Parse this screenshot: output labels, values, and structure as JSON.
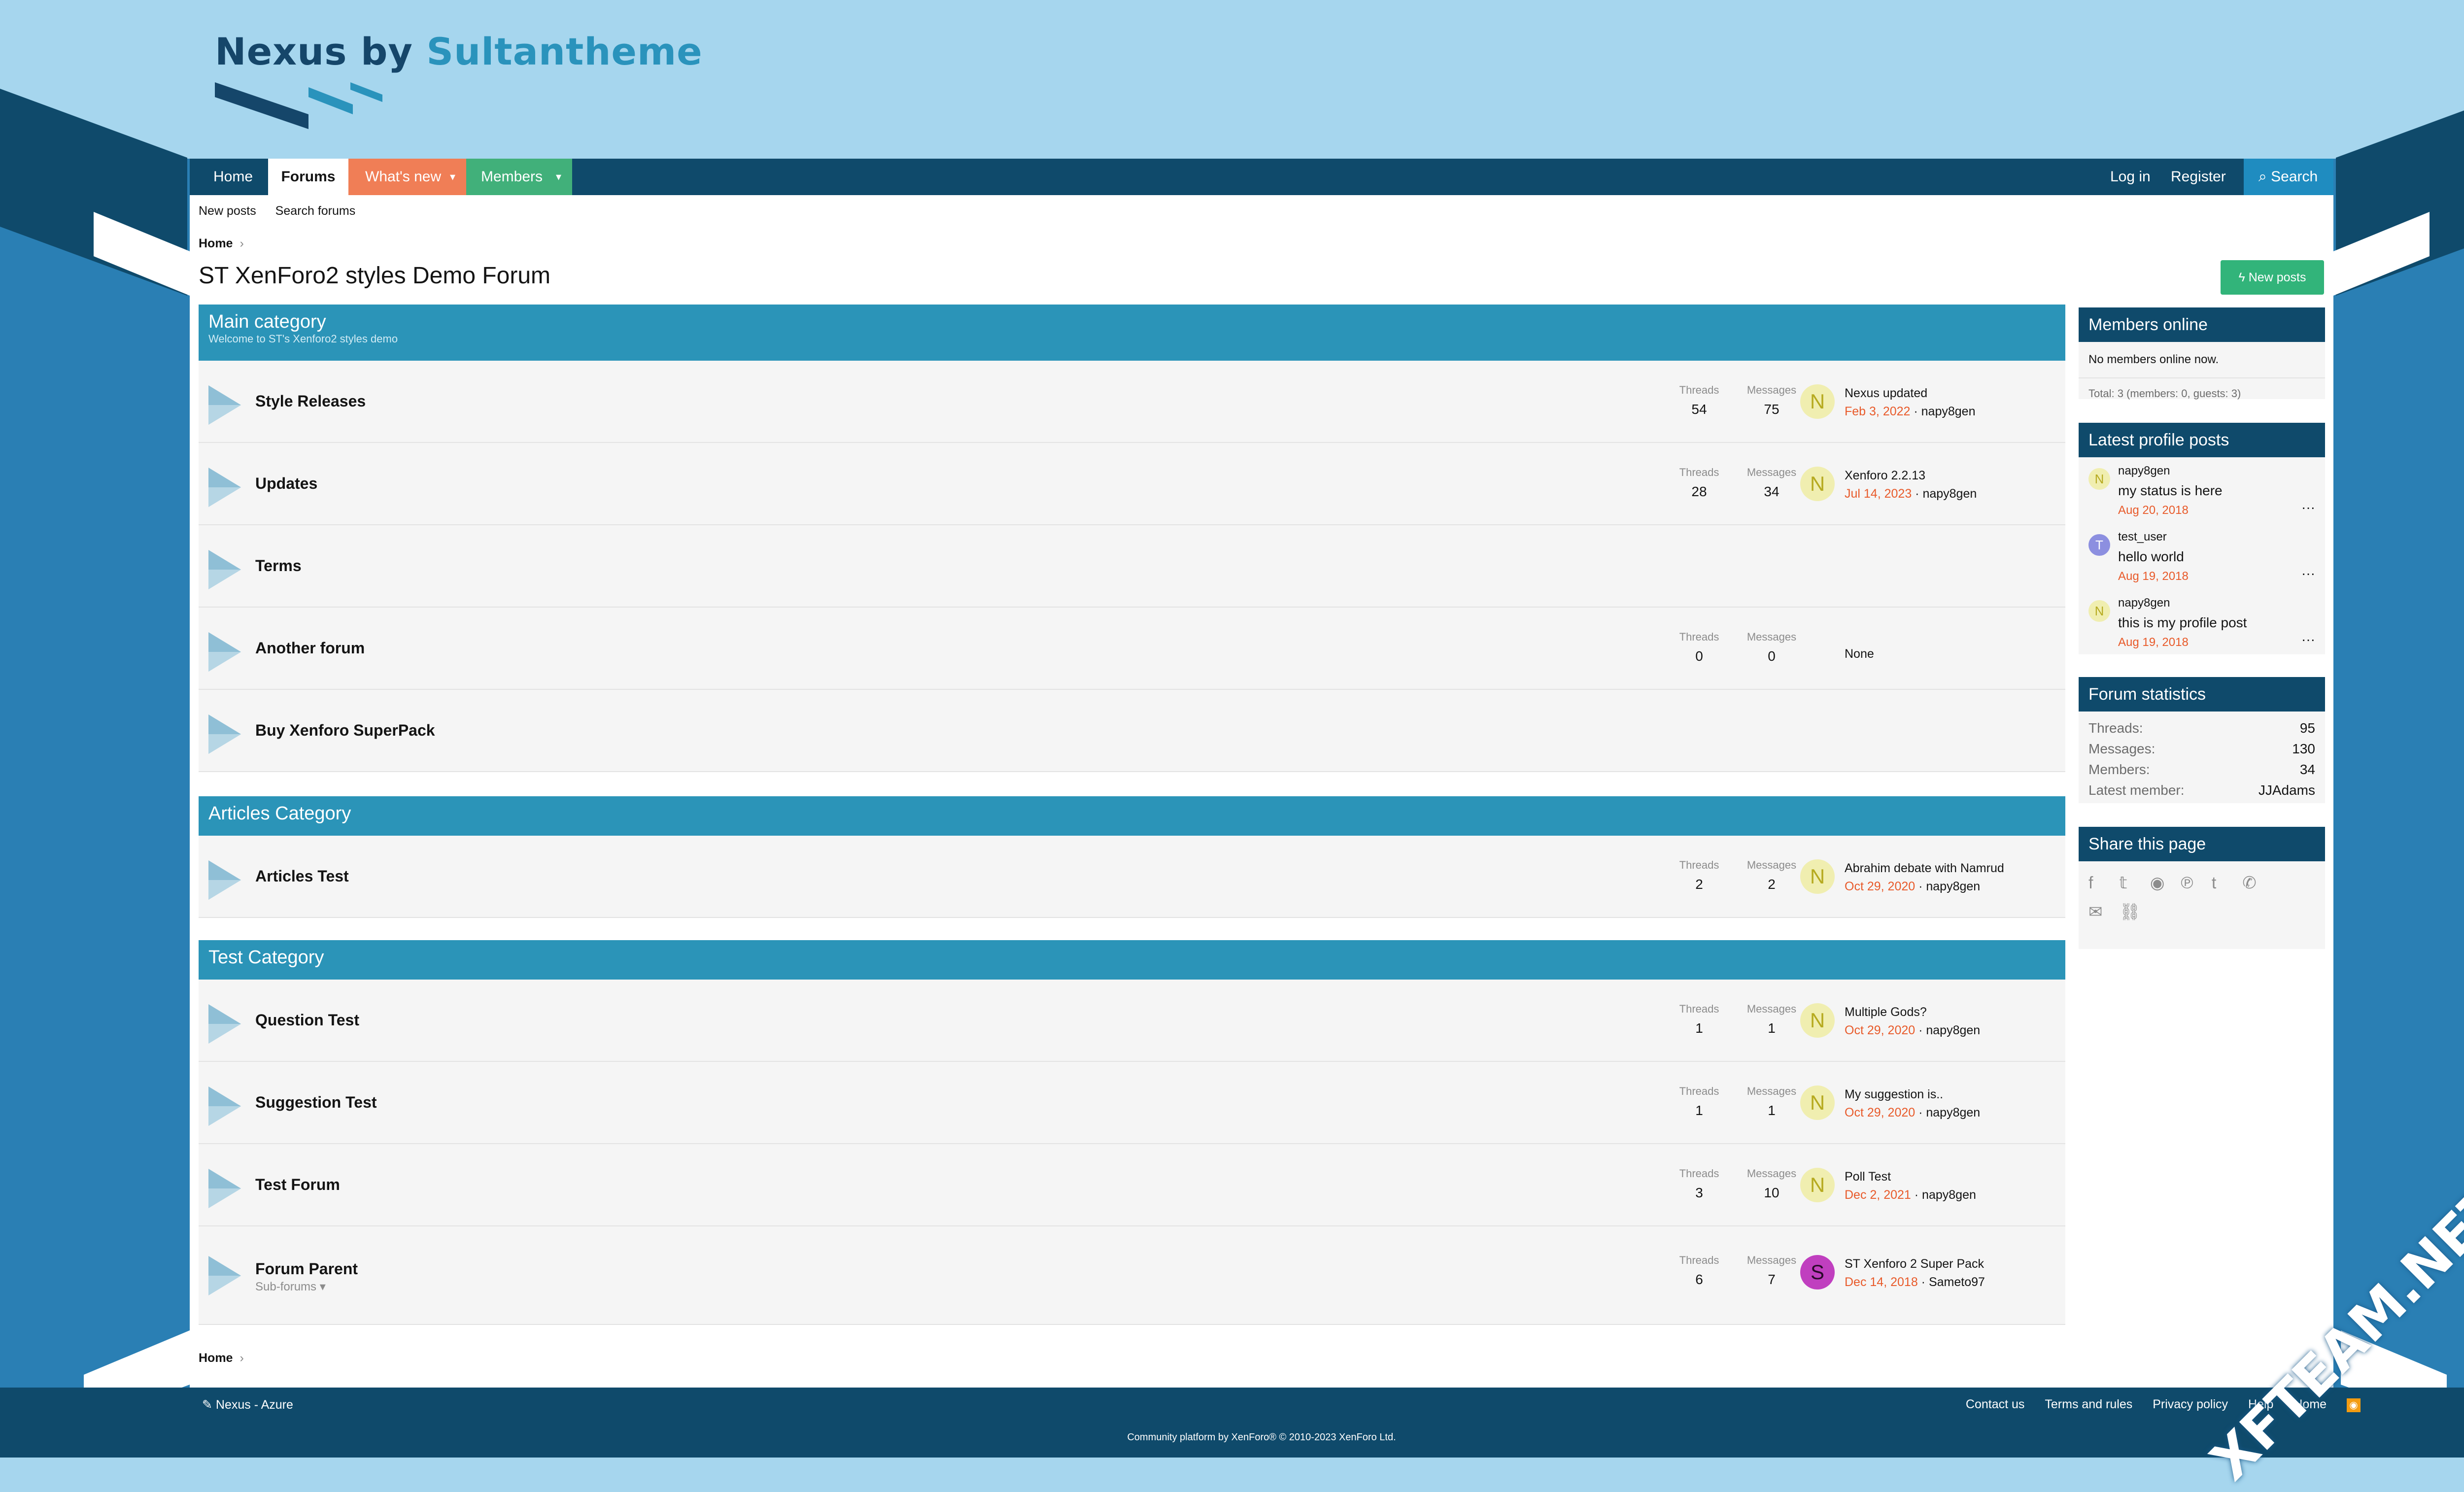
{
  "logo": {
    "part1": "Nexus by ",
    "part2": "Sultantheme"
  },
  "nav": {
    "home": "Home",
    "forums": "Forums",
    "whats_new": "What's new",
    "members": "Members",
    "login": "Log in",
    "register": "Register",
    "search": "Search"
  },
  "subnav": {
    "new_posts": "New posts",
    "search_forums": "Search forums"
  },
  "breadcrumb": {
    "home": "Home"
  },
  "page_title": "ST XenForo2 styles Demo Forum",
  "new_posts_button": "New posts",
  "labels": {
    "threads": "Threads",
    "messages": "Messages",
    "none": "None",
    "subforums": "Sub-forums"
  },
  "categories": [
    {
      "title": "Main category",
      "description": "Welcome to ST's Xenforo2 styles demo",
      "nodes": [
        {
          "title": "Style Releases",
          "threads": "54",
          "messages": "75",
          "avatar": "N",
          "last_title": "Nexus updated",
          "last_date": "Feb 3, 2022",
          "last_user": "napy8gen"
        },
        {
          "title": "Updates",
          "threads": "28",
          "messages": "34",
          "avatar": "N",
          "last_title": "Xenforo 2.2.13",
          "last_date": "Jul 14, 2023",
          "last_user": "napy8gen"
        },
        {
          "title": "Terms"
        },
        {
          "title": "Another forum",
          "threads": "0",
          "messages": "0"
        },
        {
          "title": "Buy Xenforo SuperPack"
        }
      ]
    },
    {
      "title": "Articles Category",
      "nodes": [
        {
          "title": "Articles Test",
          "threads": "2",
          "messages": "2",
          "avatar": "N",
          "last_title": "Abrahim debate with Namrud",
          "last_date": "Oct 29, 2020",
          "last_user": "napy8gen"
        }
      ]
    },
    {
      "title": "Test Category",
      "nodes": [
        {
          "title": "Question Test",
          "threads": "1",
          "messages": "1",
          "avatar": "N",
          "last_title": "Multiple Gods?",
          "last_date": "Oct 29, 2020",
          "last_user": "napy8gen"
        },
        {
          "title": "Suggestion Test",
          "threads": "1",
          "messages": "1",
          "avatar": "N",
          "last_title": "My suggestion is..",
          "last_date": "Oct 29, 2020",
          "last_user": "napy8gen"
        },
        {
          "title": "Test Forum",
          "threads": "3",
          "messages": "10",
          "avatar": "N",
          "last_title": "Poll Test",
          "last_date": "Dec 2, 2021",
          "last_user": "napy8gen"
        },
        {
          "title": "Forum Parent",
          "threads": "6",
          "messages": "7",
          "avatar": "S",
          "last_title": "ST Xenforo 2 Super Pack",
          "last_date": "Dec 14, 2018",
          "last_user": "Sameto97"
        }
      ]
    }
  ],
  "sidebar": {
    "members_online": {
      "title": "Members online",
      "status": "No members online now.",
      "total": "Total: 3 (members: 0, guests: 3)"
    },
    "profile_posts": {
      "title": "Latest profile posts",
      "items": [
        {
          "avatar": "N",
          "user": "napy8gen",
          "message": "my status is here",
          "date": "Aug 20, 2018"
        },
        {
          "avatar": "T",
          "user": "test_user",
          "message": "hello world",
          "date": "Aug 19, 2018"
        },
        {
          "avatar": "N",
          "user": "napy8gen",
          "message": "this is my profile post",
          "date": "Aug 19, 2018"
        }
      ]
    },
    "forum_statistics": {
      "title": "Forum statistics",
      "rows": [
        {
          "label": "Threads:",
          "value": "95"
        },
        {
          "label": "Messages:",
          "value": "130"
        },
        {
          "label": "Members:",
          "value": "34"
        },
        {
          "label": "Latest member:",
          "value": "JJAdams"
        }
      ]
    },
    "share": {
      "title": "Share this page"
    }
  },
  "footer": {
    "style_name": "Nexus - Azure",
    "links": [
      "Contact us",
      "Terms and rules",
      "Privacy policy",
      "Help",
      "Home"
    ],
    "copyright": "Community platform by XenForo® © 2010-2023 XenForo Ltd."
  },
  "watermark": "XFTEAM.NET",
  "colors": {
    "navbar": "#0f4a6b",
    "category": "#2b94b8",
    "whats_new": "#f07e56",
    "members": "#41b07a",
    "accent_date": "#e85a2a"
  }
}
